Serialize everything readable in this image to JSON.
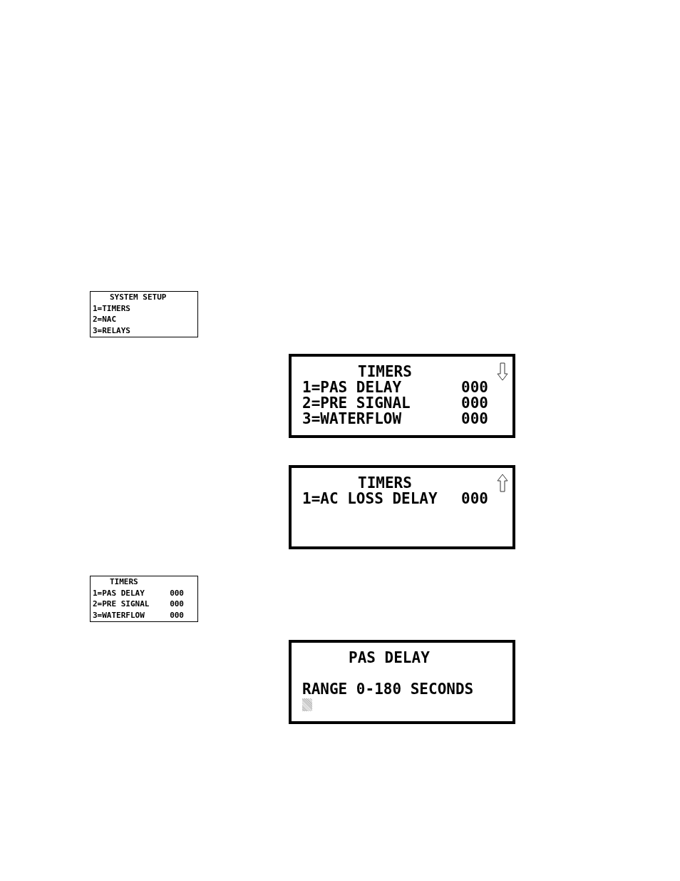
{
  "displays": [
    {
      "kind": "small",
      "title": "SYSTEM SETUP",
      "rows": [
        {
          "label": "1=TIMERS"
        },
        {
          "label": "2=NAC"
        },
        {
          "label": "3=RELAYS"
        }
      ]
    },
    {
      "kind": "large",
      "title": "TIMERS",
      "more_below": true,
      "rows": [
        {
          "label": "1=PAS DELAY",
          "value": "000"
        },
        {
          "label": "2=PRE SIGNAL",
          "value": "000"
        },
        {
          "label": "3=WATERFLOW",
          "value": "000"
        }
      ]
    },
    {
      "kind": "large",
      "title": "TIMERS",
      "more_above": true,
      "rows": [
        {
          "label": "1=AC LOSS DELAY",
          "value": "000"
        }
      ]
    },
    {
      "kind": "small",
      "title": "TIMERS",
      "rows": [
        {
          "label": "1=PAS DELAY",
          "value": "000"
        },
        {
          "label": "2=PRE SIGNAL",
          "value": "000"
        },
        {
          "label": "3=WATERFLOW",
          "value": "000"
        }
      ]
    },
    {
      "kind": "large",
      "title": "PAS DELAY",
      "rows": [
        {
          "label": "RANGE 0-180 SECONDS"
        }
      ],
      "cursor": true
    }
  ]
}
